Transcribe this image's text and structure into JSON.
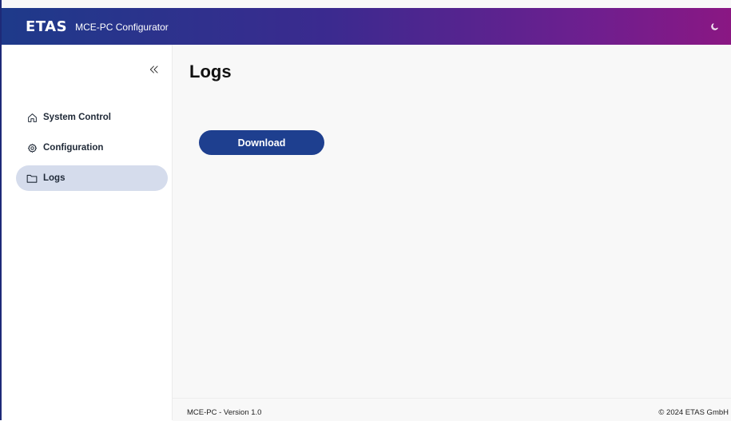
{
  "header": {
    "logo_text": "ETAS",
    "app_title": "MCE-PC Configurator",
    "theme_icon": "moon-icon"
  },
  "sidebar": {
    "collapse_icon": "double-chevron-left-icon",
    "items": [
      {
        "label": "System Control",
        "icon": "home-icon",
        "active": false
      },
      {
        "label": "Configuration",
        "icon": "gear-icon",
        "active": false
      },
      {
        "label": "Logs",
        "icon": "folder-icon",
        "active": true
      }
    ]
  },
  "main": {
    "title": "Logs",
    "download_label": "Download"
  },
  "footer": {
    "version": "MCE-PC - Version 1.0",
    "copyright": "© 2024 ETAS GmbH"
  },
  "colors": {
    "header_gradient_start": "#1e3a8a",
    "header_gradient_end": "#8a1783",
    "button_primary": "#1e3f8f",
    "nav_active_bg": "#d5dcec"
  }
}
